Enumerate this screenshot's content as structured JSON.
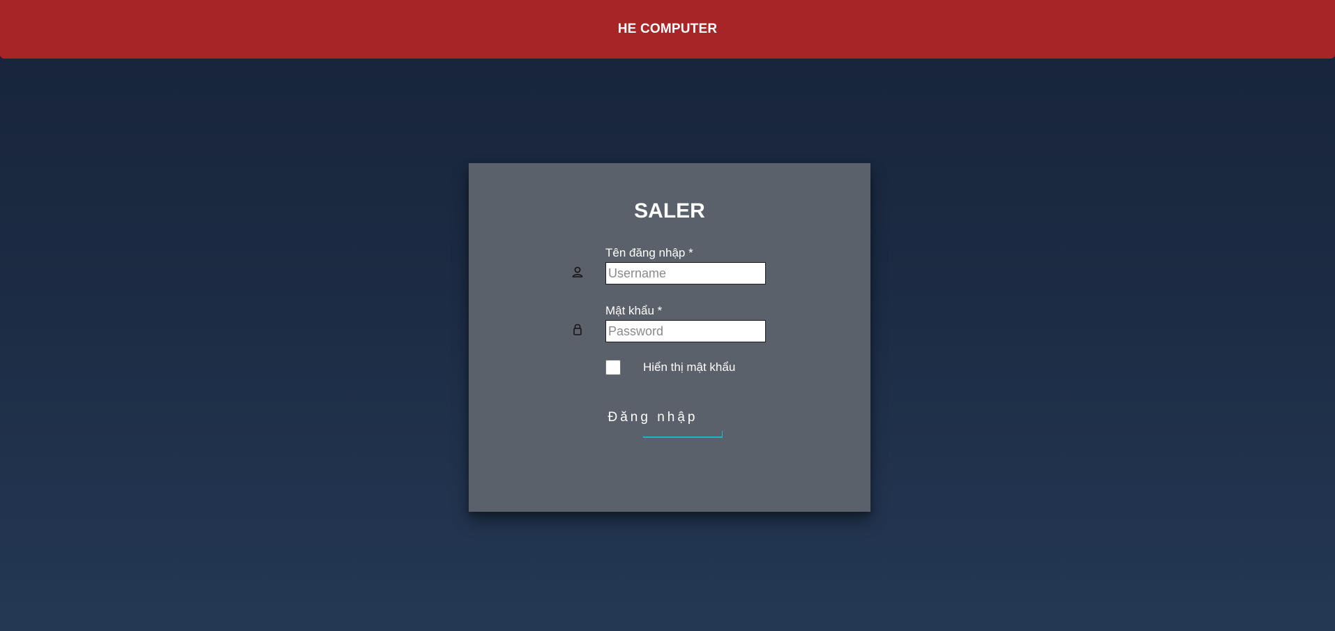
{
  "header": {
    "brand": "HE COMPUTER",
    "color": "#a82527"
  },
  "login_card": {
    "title": "SALER",
    "username": {
      "label": "Tên đăng nhập *",
      "placeholder": "Username",
      "value": "",
      "icon": "user-icon"
    },
    "password": {
      "label": "Mật khẩu *",
      "placeholder": "Password",
      "value": "",
      "icon": "lock-icon"
    },
    "show_password": {
      "label": "Hiển thị mật khẩu",
      "checked": false
    },
    "submit_label": "Đăng nhập",
    "accent_color": "#1fb5c7"
  }
}
